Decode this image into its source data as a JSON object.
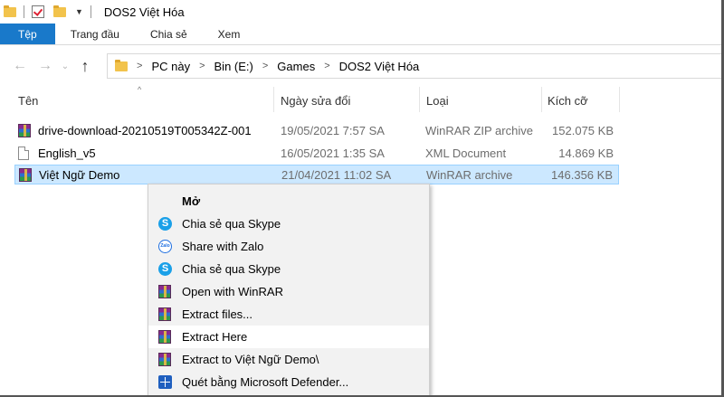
{
  "window": {
    "title": "DOS2 Việt Hóa"
  },
  "ribbon": {
    "tabs": [
      {
        "label": "Tệp",
        "active": true
      },
      {
        "label": "Trang đầu",
        "active": false
      },
      {
        "label": "Chia sẻ",
        "active": false
      },
      {
        "label": "Xem",
        "active": false
      }
    ]
  },
  "breadcrumb": [
    "PC này",
    "Bin (E:)",
    "Games",
    "DOS2 Việt Hóa"
  ],
  "columns": {
    "name": "Tên",
    "date": "Ngày sửa đổi",
    "type": "Loại",
    "size": "Kích cỡ"
  },
  "files": [
    {
      "name": "drive-download-20210519T005342Z-001",
      "date": "19/05/2021 7:57 SA",
      "type": "WinRAR ZIP archive",
      "size": "152.075 KB",
      "icon": "winrar-icon"
    },
    {
      "name": "English_v5",
      "date": "16/05/2021 1:35 SA",
      "type": "XML Document",
      "size": "14.869 KB",
      "icon": "xml-file-icon"
    },
    {
      "name": "Việt Ngữ Demo",
      "date": "21/04/2021 11:02 SA",
      "type": "WinRAR archive",
      "size": "146.356 KB",
      "icon": "winrar-icon",
      "selected": true
    }
  ],
  "context_menu": [
    {
      "label": "Mở",
      "icon": "none",
      "bold": true
    },
    {
      "label": "Chia sẻ qua Skype",
      "icon": "skype-icon"
    },
    {
      "label": "Share with Zalo",
      "icon": "zalo-icon"
    },
    {
      "label": "Chia sẻ qua Skype",
      "icon": "skype-icon"
    },
    {
      "label": "Open with WinRAR",
      "icon": "winrar-icon"
    },
    {
      "label": "Extract files...",
      "icon": "winrar-icon"
    },
    {
      "label": "Extract Here",
      "icon": "winrar-icon",
      "highlighted": true
    },
    {
      "label": "Extract to Việt Ngữ Demo\\",
      "icon": "winrar-icon"
    },
    {
      "label": "Quét bằng Microsoft Defender...",
      "icon": "defender-icon"
    }
  ],
  "icon_labels": {
    "skype": "S",
    "zalo": "Zalo"
  },
  "colors": {
    "accent": "#1979ca",
    "selection": "#cce8ff",
    "menu_bg": "#f2f2f2"
  }
}
